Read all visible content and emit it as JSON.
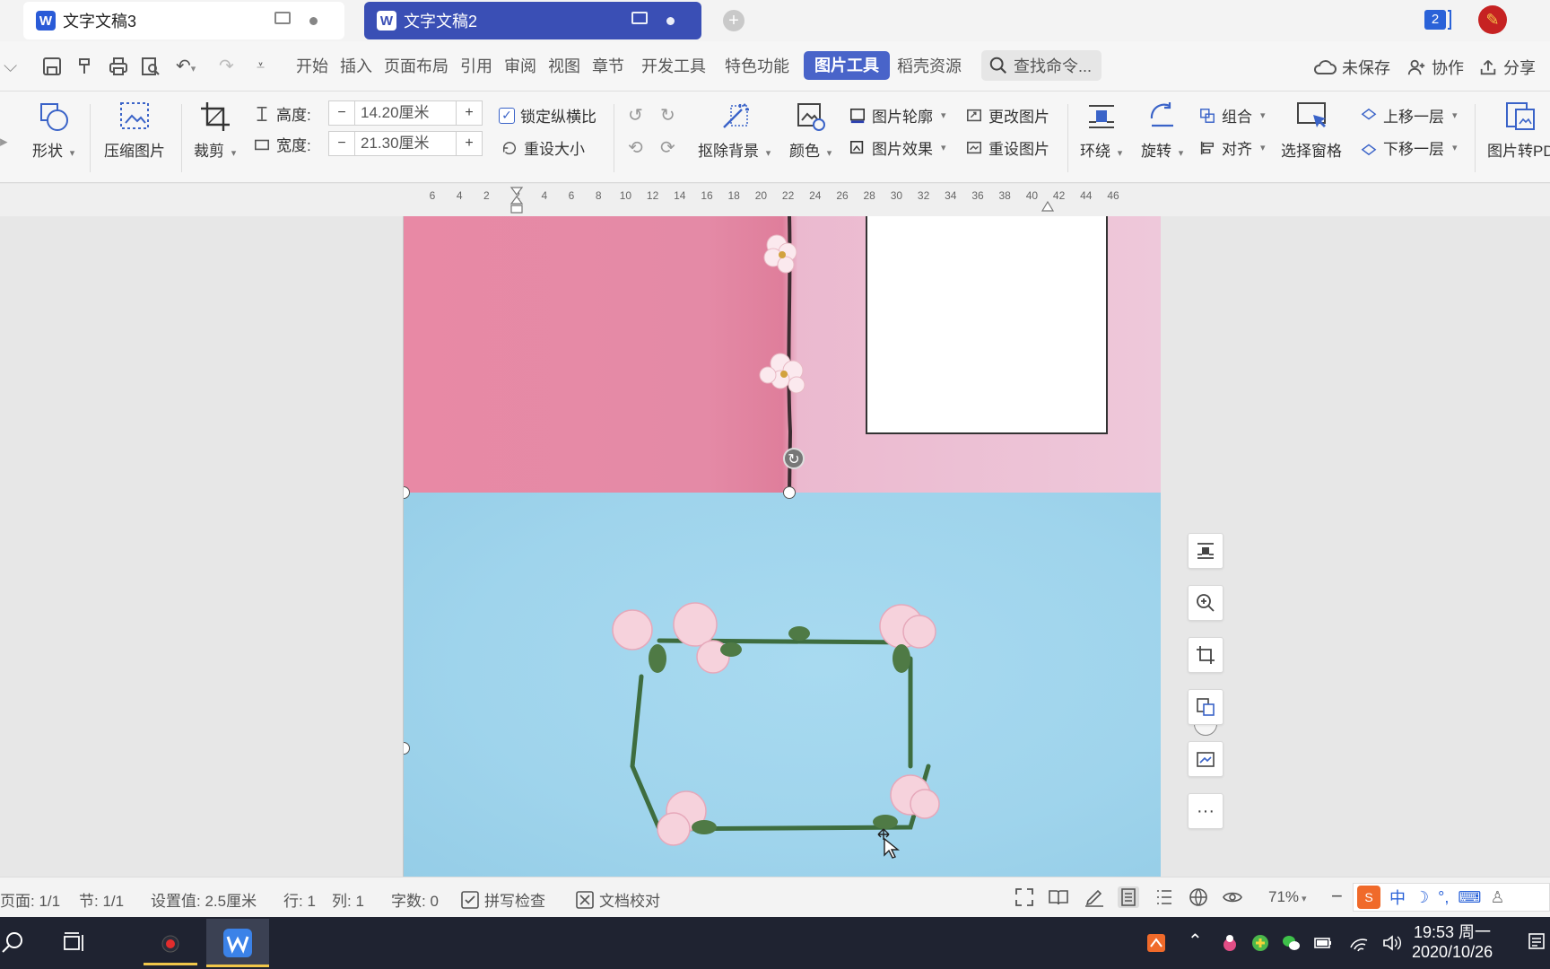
{
  "tabs": [
    {
      "title": "文字文稿3",
      "active": false
    },
    {
      "title": "文字文稿2",
      "active": true
    }
  ],
  "tab_count": "2",
  "menu": {
    "items": [
      "开始",
      "插入",
      "页面布局",
      "引用",
      "审阅",
      "视图",
      "章节",
      "开发工具",
      "特色功能"
    ],
    "active_tab": "图片工具",
    "extra_tab": "稻壳资源",
    "search_placeholder": "查找命令...",
    "unsaved": "未保存",
    "collaborate": "协作",
    "share": "分享"
  },
  "ribbon": {
    "shape": "形状",
    "compress": "压缩图片",
    "crop": "裁剪",
    "height_label": "高度:",
    "height_value": "14.20厘米",
    "width_label": "宽度:",
    "width_value": "21.30厘米",
    "minus": "−",
    "plus": "+",
    "lock_ratio": "锁定纵横比",
    "reset_size": "重设大小",
    "remove_bg": "抠除背景",
    "color": "颜色",
    "outline": "图片轮廓",
    "effects": "图片效果",
    "change_pic": "更改图片",
    "reset_pic": "重设图片",
    "wrap": "环绕",
    "rotate": "旋转",
    "group": "组合",
    "align": "对齐",
    "selection_pane": "选择窗格",
    "bring_forward": "上移一层",
    "send_backward": "下移一层",
    "pic_to_pdf": "图片转PD"
  },
  "ruler": {
    "labels": [
      "6",
      "4",
      "2",
      "2",
      "4",
      "6",
      "8",
      "10",
      "12",
      "14",
      "16",
      "18",
      "20",
      "22",
      "24",
      "26",
      "28",
      "30",
      "32",
      "34",
      "36",
      "38",
      "40",
      "42",
      "44",
      "46"
    ]
  },
  "side_tools": {
    "more": "···"
  },
  "status": {
    "page": "页面: 1/1",
    "section": "节: 1/1",
    "setting": "设置值: 2.5厘米",
    "row": "行: 1",
    "col": "列: 1",
    "words": "字数: 0",
    "spell": "拼写检查",
    "proof": "文档校对",
    "zoom": "71%",
    "zoom_minus": "−",
    "ime_zh": "中"
  },
  "taskbar": {
    "time": "19:53 周一",
    "date": "2020/10/26"
  },
  "colors": {
    "active_tab": "#3a4fb5",
    "accent": "#4964c9",
    "pink": "#e48aa6",
    "blue": "#9fd4ec",
    "taskbar": "#1f2331"
  }
}
